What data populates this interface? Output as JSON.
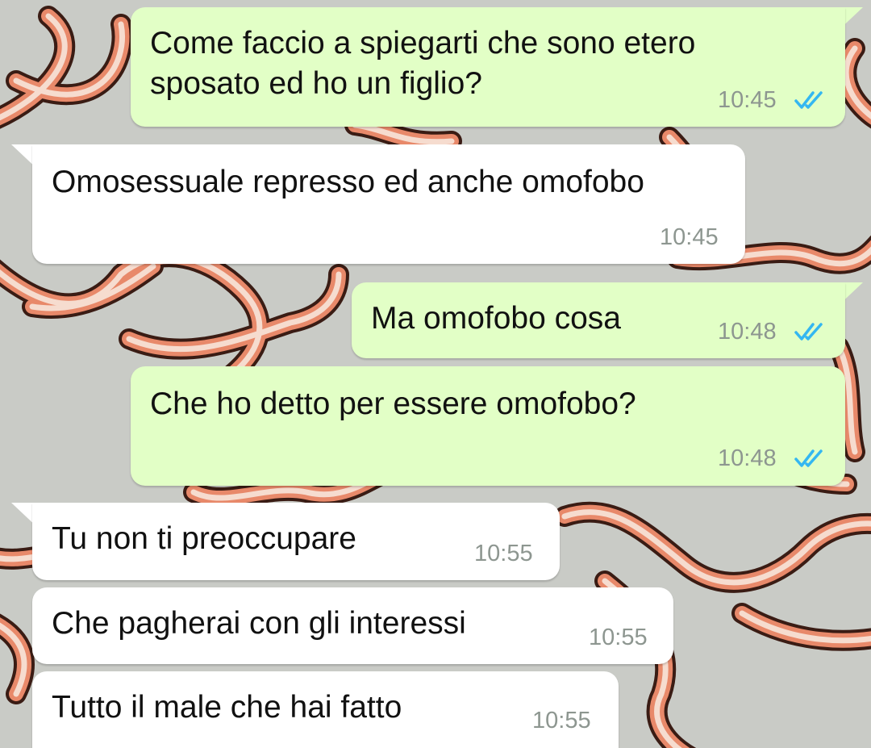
{
  "theme": {
    "outgoing_bubble": "#e2ffc6",
    "incoming_bubble": "#ffffff",
    "read_tick_color": "#34b7f1",
    "wallpaper_base": "#c9cbc6",
    "wallpaper_stroke": "#e8896a"
  },
  "messages": [
    {
      "direction": "outgoing",
      "text": "Come faccio a spiegarti che sono etero\nsposato ed ho un figlio?",
      "time": "10:45",
      "status": "read-double-tick-icon"
    },
    {
      "direction": "incoming",
      "text": "Omosessuale represso ed anche omofobo",
      "time": "10:45"
    },
    {
      "direction": "outgoing",
      "text": "Ma omofobo cosa",
      "time": "10:48",
      "status": "read-double-tick-icon"
    },
    {
      "direction": "outgoing",
      "text": "Che ho detto per essere omofobo?",
      "time": "10:48",
      "status": "read-double-tick-icon"
    },
    {
      "direction": "incoming",
      "text": "Tu non ti preoccupare",
      "time": "10:55"
    },
    {
      "direction": "incoming",
      "text": "Che pagherai con gli interessi",
      "time": "10:55"
    },
    {
      "direction": "incoming",
      "text": "Tutto il male che hai fatto",
      "time": "10:55"
    }
  ]
}
